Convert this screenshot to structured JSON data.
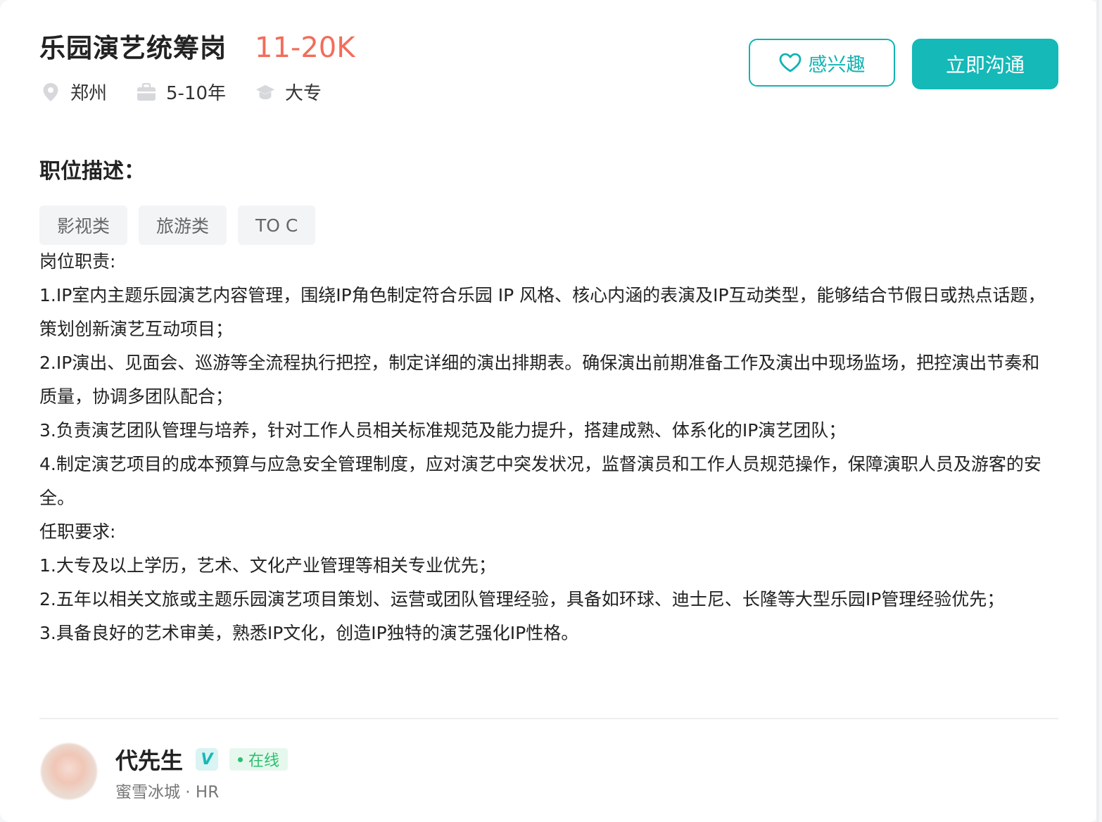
{
  "job": {
    "title": "乐园演艺统筹岗",
    "salary": "11-20K",
    "location": "郑州",
    "experience": "5-10年",
    "education": "大专"
  },
  "actions": {
    "interest_label": "感兴趣",
    "chat_label": "立即沟通"
  },
  "description": {
    "section_title": "职位描述：",
    "tags": [
      "影视类",
      "旅游类",
      "TO C"
    ],
    "lines": [
      "岗位职责:",
      "1.IP室内主题乐园演艺内容管理，围绕IP角色制定符合乐园 IP 风格、核心内涵的表演及IP互动类型，能够结合节假日或热点话题，策划创新演艺互动项目；",
      "2.IP演出、见面会、巡游等全流程执行把控，制定详细的演出排期表。确保演出前期准备工作及演出中现场监场，把控演出节奏和质量，协调多团队配合；",
      "3.负责演艺团队管理与培养，针对工作人员相关标准规范及能力提升，搭建成熟、体系化的IP演艺团队；",
      "4.制定演艺项目的成本预算与应急安全管理制度，应对演艺中突发状况，监督演员和工作人员规范操作，保障演职人员及游客的安全。",
      "任职要求:",
      "1.大专及以上学历，艺术、文化产业管理等相关专业优先；",
      "2.五年以相关文旅或主题乐园演艺项目策划、运营或团队管理经验，具备如环球、迪士尼、长隆等大型乐园IP管理经验优先；",
      "3.具备良好的艺术审美，熟悉IP文化，创造IP独特的演艺强化IP性格。"
    ]
  },
  "recruiter": {
    "name": "代先生",
    "verified_badge": "V",
    "status": "在线",
    "company_role": "蜜雪冰城 · HR"
  },
  "colors": {
    "accent": "#14b9b8",
    "salary": "#f26d5b",
    "online": "#2cbf6d"
  }
}
